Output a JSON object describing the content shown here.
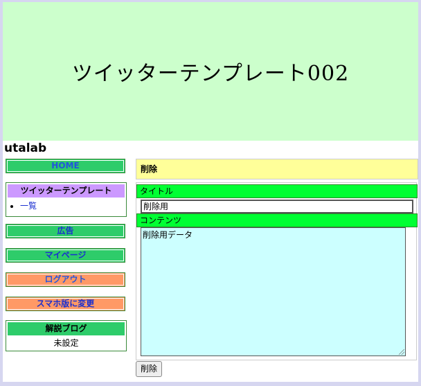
{
  "banner": {
    "title": "ツイッターテンプレート002"
  },
  "site": {
    "name": "utalab"
  },
  "sidebar": {
    "home_label": "HOME",
    "twitter_box": {
      "title": "ツイッターテンプレート",
      "items": [
        "一覧"
      ]
    },
    "ad_label": "広告",
    "mypage_label": "マイページ",
    "logout_label": "ログアウト",
    "mobile_label": "スマホ版に変更",
    "blog_box": {
      "title": "解説ブログ",
      "value": "未設定"
    }
  },
  "main": {
    "heading": "削除",
    "form": {
      "title_label": "タイトル",
      "title_value": "削除用",
      "content_label": "コンテンツ",
      "content_value": "削除用データ"
    },
    "delete_button": "削除"
  },
  "colors": {
    "banner_bg": "#ccffcc",
    "nav_green": "#2ecc6a",
    "nav_orange": "#ff9966",
    "header_yellow": "#ffff99",
    "field_label_green": "#00ff33",
    "textarea_bg": "#ccffff",
    "twitter_head": "#cc99ff"
  }
}
